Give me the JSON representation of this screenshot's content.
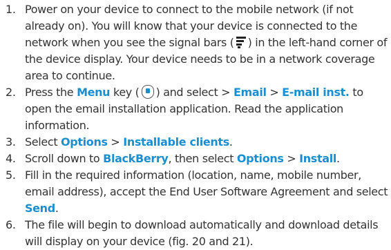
{
  "accent_color": "#1a8fd0",
  "icons": [
    "signal-bars-icon",
    "menu-key-icon"
  ],
  "steps": [
    {
      "num": "1.",
      "a": "Power on your device to connect to the mobile network (if not already on). You will know that your device is connected to the network when you see the signal bars (",
      "b": ") in the left-hand corner of the device display. Your device needs to be in a network coverage area to continue."
    },
    {
      "num": "2.",
      "a": "Press the",
      "menu": "Menu",
      "b": "key (",
      "c": ") and select >",
      "email": "Email",
      "d": ">",
      "email_inst": "E-mail inst.",
      "e": "to open the email installation application. Read the application information."
    },
    {
      "num": "3.",
      "a": "Select",
      "options": "Options",
      "b": ">",
      "clients": "Installable clients",
      "c": "."
    },
    {
      "num": "4.",
      "a": "Scroll down to",
      "blackberry": "BlackBerry",
      "b": ", then select",
      "options": "Options",
      "c": ">",
      "install": "Install",
      "d": "."
    },
    {
      "num": "5.",
      "a": "Fill in the required information (location, name, mobile number, email address), accept the End User Software Agreement and select",
      "send": "Send",
      "b": "."
    },
    {
      "num": "6.",
      "a": "The file will begin to download automatically and download details will display on your device (fig. 20 and 21)."
    }
  ]
}
